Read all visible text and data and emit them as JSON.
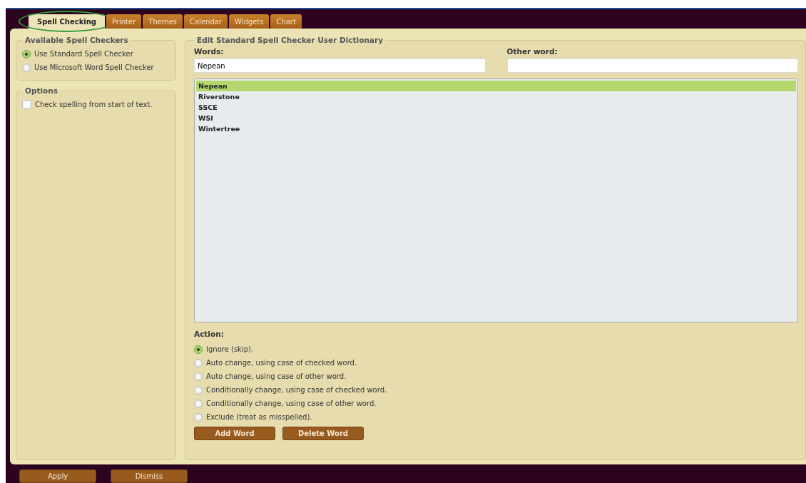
{
  "tabs": [
    {
      "label": "Spell Checking",
      "selected": true,
      "highlighted": true
    },
    {
      "label": "Printer",
      "selected": false,
      "highlighted": false
    },
    {
      "label": "Themes",
      "selected": false,
      "highlighted": false
    },
    {
      "label": "Calendar",
      "selected": false,
      "highlighted": false
    },
    {
      "label": "Widgets",
      "selected": false,
      "highlighted": false
    },
    {
      "label": "Chart",
      "selected": false,
      "highlighted": false
    }
  ],
  "available_spell_checkers": {
    "title": "Available Spell Checkers",
    "options": [
      {
        "label": "Use Standard Spell Checker",
        "selected": true
      },
      {
        "label": "Use Microsoft Word Spell Checker",
        "selected": false
      }
    ]
  },
  "options": {
    "title": "Options",
    "items": [
      {
        "label": "Check spelling from start of text.",
        "checked": false
      }
    ]
  },
  "dictionary": {
    "title": "Edit Standard Spell Checker User Dictionary",
    "words": {
      "label": "Words:",
      "value": "Nepean"
    },
    "other_word": {
      "label": "Other word:"
    },
    "list": [
      {
        "label": "Nepean",
        "selected": true
      },
      {
        "label": "Riverstone",
        "selected": false
      },
      {
        "label": "SSCE",
        "selected": false
      },
      {
        "label": "WSI",
        "selected": false
      },
      {
        "label": "Wintertree",
        "selected": false
      }
    ],
    "action": {
      "label": "Action:",
      "options": [
        {
          "label": "Ignore (skip).",
          "selected": true
        },
        {
          "label": "Auto change, using case of checked word.",
          "selected": false
        },
        {
          "label": "Auto change, using case of other word.",
          "selected": false
        },
        {
          "label": "Conditionally change, using case of checked word.",
          "selected": false
        },
        {
          "label": "Conditionally change, using case of other word.",
          "selected": false
        },
        {
          "label": "Exclude (treat as misspelled).",
          "selected": false
        }
      ]
    },
    "buttons": [
      "Add Word",
      "Delete Word"
    ]
  },
  "footer_buttons": [
    "Apply",
    "Dismiss"
  ]
}
